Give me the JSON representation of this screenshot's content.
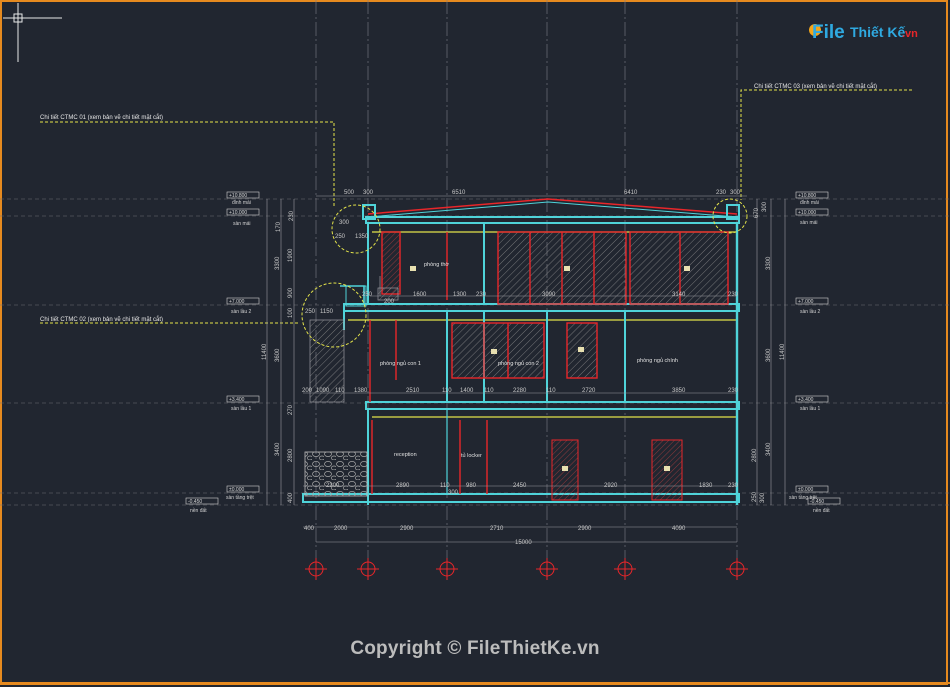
{
  "drawing": {
    "callouts": {
      "detail_1": "Chi tiết CTMC 01 (xem bản vẽ chi tiết mặt cắt)",
      "detail_2": "Chi tiết CTMC 02 (xem bản vẽ chi tiết mặt cắt)",
      "detail_3": "Chi tiết CTMC 03 (xem bản vẽ chi tiết mặt cắt)"
    },
    "rooms": {
      "r1": "phòng thờ",
      "r2": "phòng ngủ con 1",
      "r3": "phòng ngủ con 2",
      "r4": "phòng ngủ chính",
      "r5": "reception",
      "r6": "tủ locker"
    },
    "levels_left": {
      "l1_val": "+10.800",
      "l1_name": "đỉnh mái",
      "l2_val": "+10.000",
      "l2_name": "sàn mái",
      "l3_val": "+7.000",
      "l3_name": "sàn lầu 2",
      "l4_val": "+3.400",
      "l4_name": "sàn lầu 1",
      "l5_val": "±0.000",
      "l5_name": "sàn tầng trệt",
      "l6_val": "-0.450",
      "l6_name": "nền đất"
    },
    "levels_right": {
      "l1_val": "+10.800",
      "l1_name": "đỉnh mái",
      "l2_val": "+10.000",
      "l2_name": "sàn mái",
      "l3_val": "+7.000",
      "l3_name": "sàn lầu 2",
      "l4_val": "+3.400",
      "l4_name": "sàn lầu 1",
      "l5_val": "±0.000",
      "l5_name": "sàn tầng trệt",
      "l6_val": "-0.450",
      "l6_name": "nền đất"
    },
    "dims_top": {
      "d1": "500",
      "d2": "300",
      "d3": "6510",
      "d4": "6410",
      "d5": "230",
      "d6": "300"
    },
    "dims_roof": {
      "a": "300",
      "b": "250",
      "c": "1350"
    },
    "dims_upper": {
      "a": "250",
      "b": "1600",
      "c": "1300",
      "d": "230",
      "e": "3090",
      "f": "3140",
      "g": "230",
      "h": "200"
    },
    "dims_upper2": {
      "a": "250",
      "b": "1150"
    },
    "dims_mid": {
      "a": "200",
      "b": "1090",
      "c": "110",
      "d": "1380",
      "e": "2510",
      "f": "110",
      "g": "1400",
      "h": "110",
      "i": "2280",
      "j": "110",
      "k": "2720",
      "l": "3850",
      "m": "230"
    },
    "dims_ground": {
      "a": "2300",
      "b": "2890",
      "c": "110",
      "d": "980",
      "e": "2450",
      "f": "2920",
      "g": "1830",
      "h": "230",
      "i": "300"
    },
    "dims_bottom": {
      "a": "400",
      "b": "2000",
      "c": "2900",
      "d": "2710",
      "e": "2900",
      "f": "4090",
      "total": "15000"
    },
    "dims_vertical_left": {
      "a": "170",
      "b": "230",
      "c": "3300",
      "d": "1900",
      "e": "900",
      "f": "11400",
      "g": "3600",
      "h": "3400",
      "i": "2800",
      "j": "400",
      "k": "270",
      "l": "100"
    },
    "dims_vertical_right": {
      "a": "300",
      "b": "670",
      "c": "3300",
      "d": "11400",
      "e": "3600",
      "f": "3400",
      "g": "2800",
      "h": "250",
      "i": "300"
    }
  },
  "watermark": {
    "logo_file": "File",
    "logo_name": "Thiết Kế",
    "logo_tld": ".vn",
    "copyright": "Copyright © FileThietKe.vn"
  },
  "colors": {
    "background": "#212630",
    "slab": "#4fd3d9",
    "wall_red": "#e8262a",
    "yellow": "#e3e34a",
    "grid": "#9a9aa0",
    "frame_orange": "#e68a1f"
  }
}
